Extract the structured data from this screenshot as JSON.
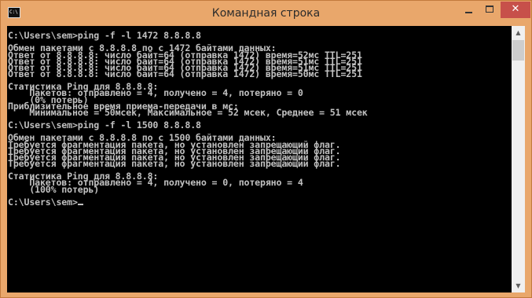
{
  "window": {
    "title": "Командная строка",
    "icon_label": "C:\\",
    "buttons": {
      "minimize": "minimize",
      "maximize": "maximize",
      "close": "✕"
    }
  },
  "console": {
    "lines": [
      "",
      "C:\\Users\\sem>ping -f -l 1472 8.8.8.8",
      "",
      "Обмен пакетами с 8.8.8.8 по с 1472 байтами данных:",
      "Ответ от 8.8.8.8: число байт=64 (отправка 1472) время=52мс TTL=251",
      "Ответ от 8.8.8.8: число байт=64 (отправка 1472) время=51мс TTL=251",
      "Ответ от 8.8.8.8: число байт=64 (отправка 1472) время=51мс TTL=251",
      "Ответ от 8.8.8.8: число байт=64 (отправка 1472) время=50мс TTL=251",
      "",
      "Статистика Ping для 8.8.8.8:",
      "    Пакетов: отправлено = 4, получено = 4, потеряно = 0",
      "    (0% потерь)",
      "Приблизительное время приема-передачи в мс:",
      "    Минимальное = 50мсек, Максимальное = 52 мсек, Среднее = 51 мсек",
      "",
      "C:\\Users\\sem>ping -f -l 1500 8.8.8.8",
      "",
      "Обмен пакетами с 8.8.8.8 по с 1500 байтами данных:",
      "Требуется фрагментация пакета, но установлен запрещающий флаг.",
      "Требуется фрагментация пакета, но установлен запрещающий флаг.",
      "Требуется фрагментация пакета, но установлен запрещающий флаг.",
      "Требуется фрагментация пакета, но установлен запрещающий флаг.",
      "",
      "Статистика Ping для 8.8.8.8:",
      "    Пакетов: отправлено = 4, получено = 0, потеряно = 4",
      "    (100% потерь)",
      ""
    ],
    "prompt": "C:\\Users\\sem>"
  },
  "colors": {
    "titlebar": "#e9a76b",
    "console_bg": "#000000",
    "console_fg": "#c0c0c0",
    "close_button": "#c7504a"
  },
  "scrollbar": {
    "up_arrow": "▲",
    "down_arrow": "▼"
  }
}
